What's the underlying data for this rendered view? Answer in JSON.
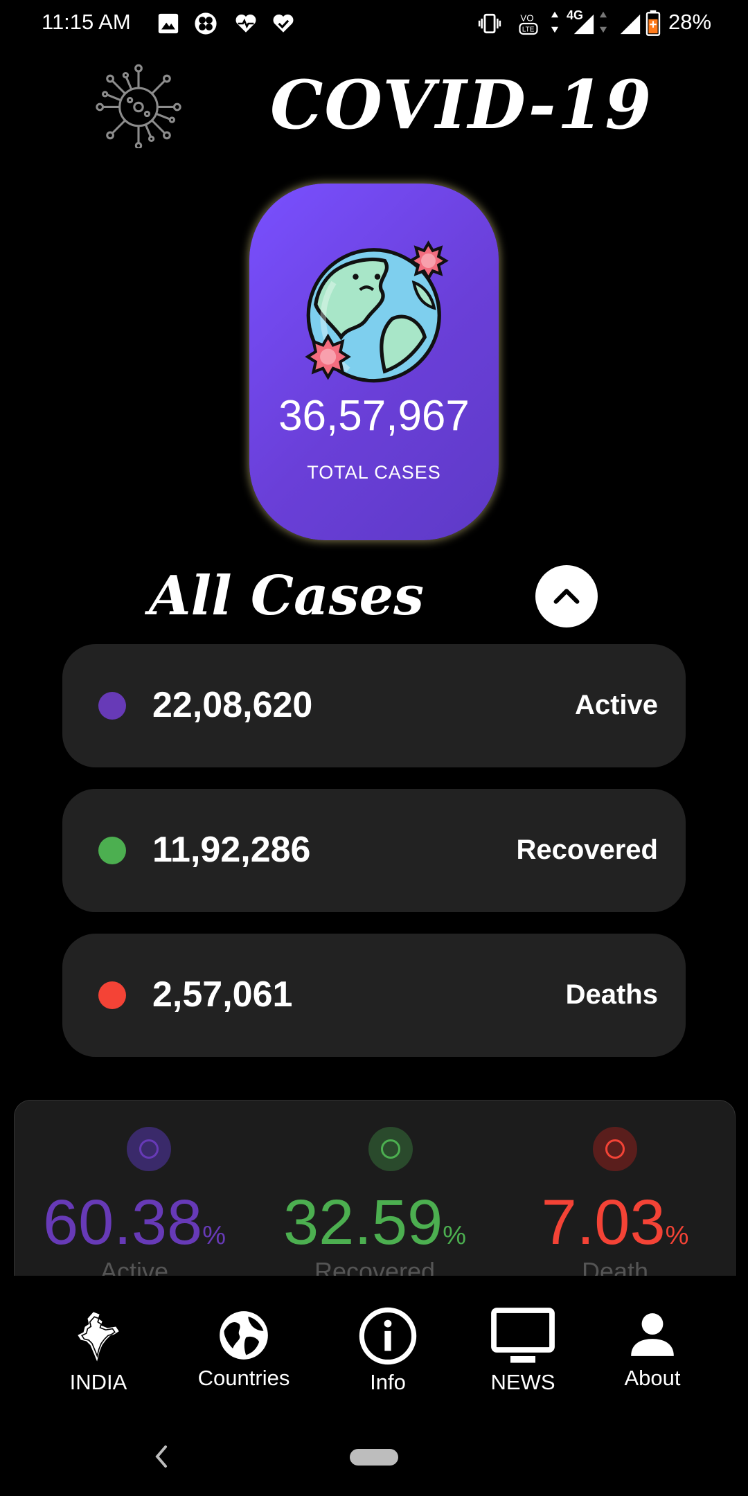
{
  "status_bar": {
    "time": "11:15 AM",
    "network": "4G",
    "battery": "28%",
    "icons": [
      "image-icon",
      "fan-icon",
      "heart-pulse-icon",
      "heart-check-icon",
      "vibrate-icon",
      "volte-icon",
      "signal-icon",
      "signal-icon",
      "battery-icon"
    ]
  },
  "header": {
    "title": "COVID-19",
    "logo_icon": "virus-icon"
  },
  "total": {
    "value": "36,57,967",
    "label": "TOTAL CASES",
    "icon": "sick-globe-icon"
  },
  "all_cases": {
    "title": "All Cases",
    "toggle_icon": "chevron-up-icon",
    "rows": [
      {
        "value": "22,08,620",
        "label": "Active",
        "color": "#673ab7"
      },
      {
        "value": "11,92,286",
        "label": "Recovered",
        "color": "#4caf50"
      },
      {
        "value": "2,57,061",
        "label": "Deaths",
        "color": "#f44336"
      }
    ]
  },
  "percentages": [
    {
      "value": "60.38",
      "sign": "%",
      "label": "Active",
      "color": "#673ab7"
    },
    {
      "value": "32.59",
      "sign": "%",
      "label": "Recovered",
      "color": "#4caf50"
    },
    {
      "value": "7.03",
      "sign": "%",
      "label": "Death",
      "color": "#f44336"
    }
  ],
  "bottom_nav": [
    {
      "label": "INDIA",
      "icon": "india-map-icon"
    },
    {
      "label": "Countries",
      "icon": "globe-icon"
    },
    {
      "label": "Info",
      "icon": "info-icon"
    },
    {
      "label": "NEWS",
      "icon": "tv-icon"
    },
    {
      "label": "About",
      "icon": "person-icon"
    }
  ]
}
